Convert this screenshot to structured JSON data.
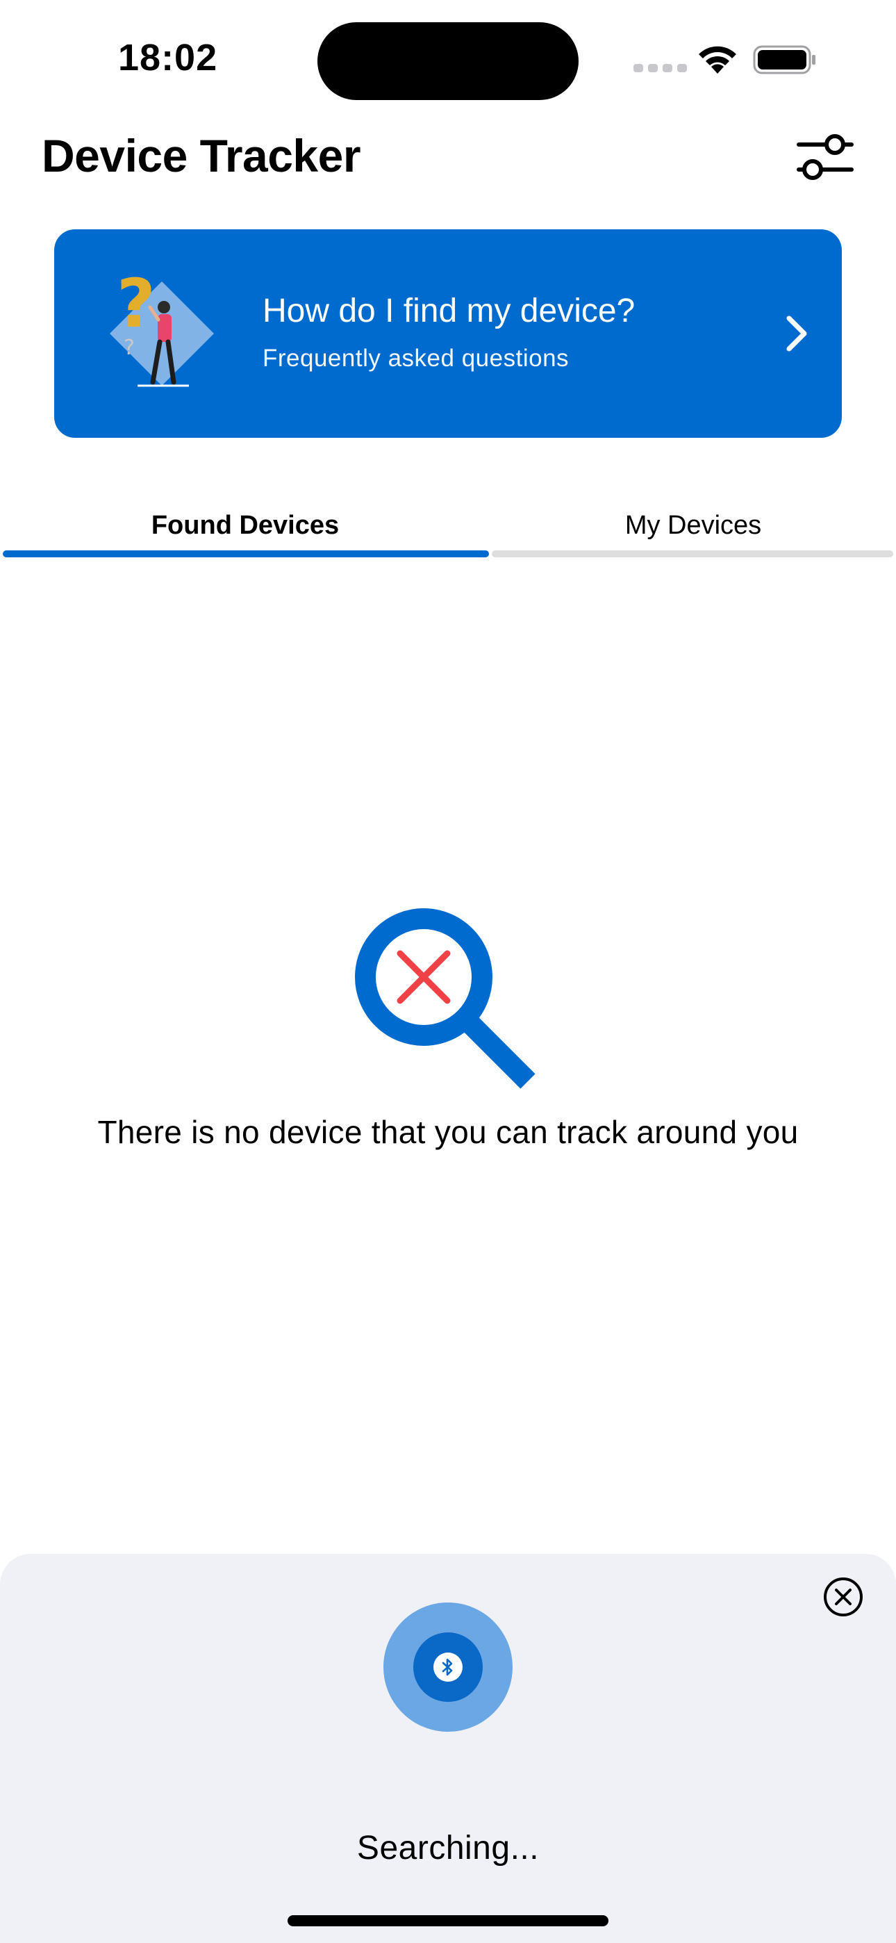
{
  "status_bar": {
    "time": "18:02",
    "icons": [
      "cellular-signal-icon",
      "wifi-icon",
      "battery-icon"
    ]
  },
  "header": {
    "title": "Device Tracker",
    "filter_icon": "sliders-icon"
  },
  "faq_banner": {
    "title": "How do I find my device?",
    "subtitle": "Frequently asked questions",
    "background_color": "#006bcf",
    "chevron_icon": "chevron-right-icon"
  },
  "tabs": [
    {
      "label": "Found Devices",
      "active": true
    },
    {
      "label": "My Devices",
      "active": false
    }
  ],
  "accent_color": "#006bcf",
  "empty_state": {
    "icon": "magnifier-no-results-icon",
    "message": "There is no device that you can track around you"
  },
  "search_sheet": {
    "status": "Searching...",
    "icon": "bluetooth-icon",
    "close_icon": "close-circle-icon"
  }
}
